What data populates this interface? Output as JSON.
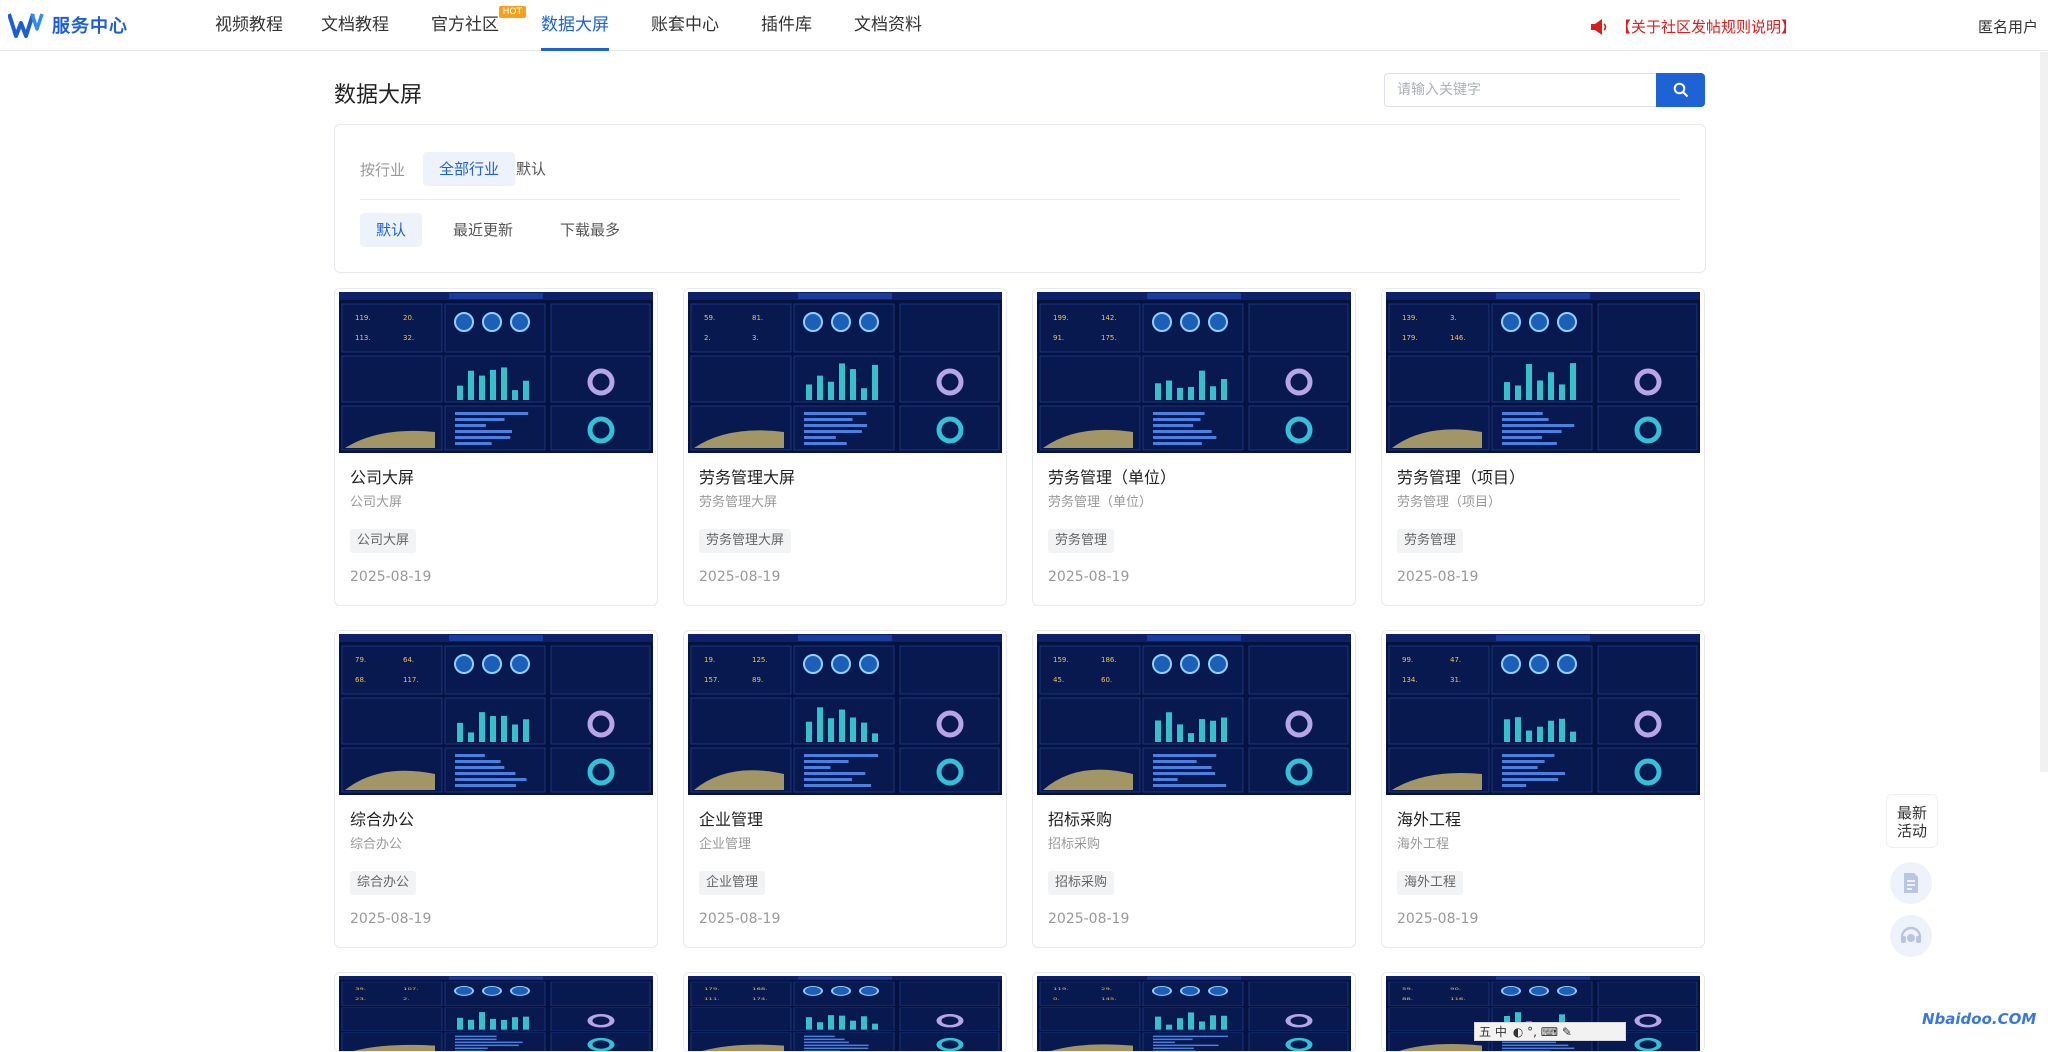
{
  "header": {
    "logo_text": "服务中心",
    "nav": [
      {
        "label": "视频教程",
        "active": false
      },
      {
        "label": "文档教程",
        "active": false
      },
      {
        "label": "官方社区",
        "active": false,
        "badge": "HOT"
      },
      {
        "label": "数据大屏",
        "active": true
      },
      {
        "label": "账套中心",
        "active": false
      },
      {
        "label": "插件库",
        "active": false
      },
      {
        "label": "文档资料",
        "active": false
      }
    ],
    "notice": "【关于社区发帖规则说明】",
    "user": "匿名用户"
  },
  "page_title": "数据大屏",
  "search": {
    "placeholder": "请输入关键字",
    "value": ""
  },
  "filters": {
    "industry_label": "按行业",
    "industry_options": [
      "全部行业",
      "默认"
    ],
    "industry_selected": "全部行业",
    "sort_options": [
      "默认",
      "最近更新",
      "下载最多"
    ],
    "sort_selected": "默认"
  },
  "cards": [
    {
      "title": "公司大屏",
      "subtitle": "公司大屏",
      "tag": "公司大屏",
      "date": "2025-08-19"
    },
    {
      "title": "劳务管理大屏",
      "subtitle": "劳务管理大屏",
      "tag": "劳务管理大屏",
      "date": "2025-08-19"
    },
    {
      "title": "劳务管理（单位）",
      "subtitle": "劳务管理（单位）",
      "tag": "劳务管理",
      "date": "2025-08-19"
    },
    {
      "title": "劳务管理（项目）",
      "subtitle": "劳务管理（项目）",
      "tag": "劳务管理",
      "date": "2025-08-19"
    },
    {
      "title": "综合办公",
      "subtitle": "综合办公",
      "tag": "综合办公",
      "date": "2025-08-19"
    },
    {
      "title": "企业管理",
      "subtitle": "企业管理",
      "tag": "企业管理",
      "date": "2025-08-19"
    },
    {
      "title": "招标采购",
      "subtitle": "招标采购",
      "tag": "招标采购",
      "date": "2025-08-19"
    },
    {
      "title": "海外工程",
      "subtitle": "海外工程",
      "tag": "海外工程",
      "date": "2025-08-19"
    }
  ],
  "float": {
    "activity_label": "最新\n活动"
  },
  "watermark": "Nbaidoo.COM",
  "ime_label": "五 中"
}
